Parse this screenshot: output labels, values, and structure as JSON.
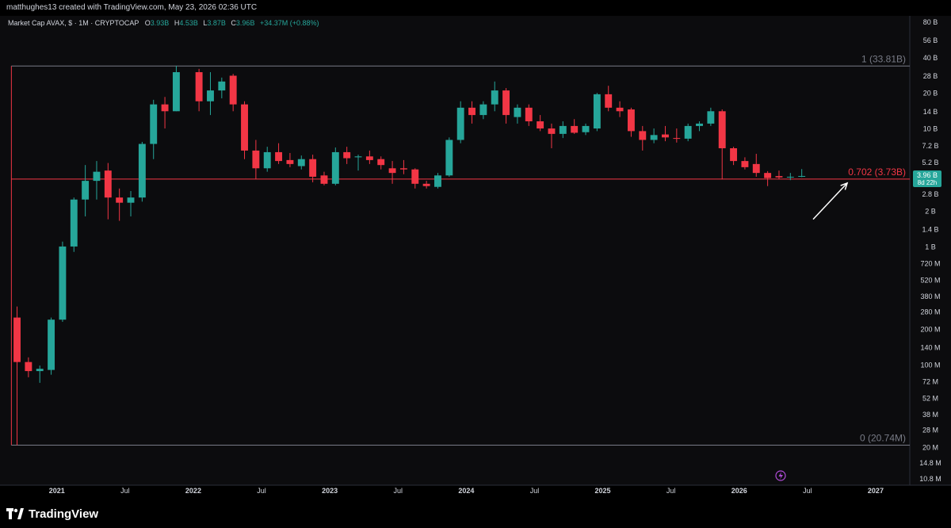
{
  "header": {
    "attribution": "matthughes13 created with TradingView.com, May 23, 2026 02:36 UTC"
  },
  "legend": {
    "symbol": "Market Cap AVAX, $ · 1M · CRYPTOCAP",
    "o_label": "O",
    "o_value": "3.93B",
    "h_label": "H",
    "h_value": "4.53B",
    "l_label": "L",
    "l_value": "3.87B",
    "c_label": "C",
    "c_value": "3.96B",
    "change": "+34.37M (+0.88%)"
  },
  "footer": {
    "brand": "TradingView"
  },
  "colors": {
    "up": "#26a69a",
    "down": "#f23645",
    "fib_line": "#f23645",
    "fib_top": "#5d606b",
    "axis_text": "#d1d4dc"
  },
  "chart_data": {
    "type": "candlestick",
    "interval": "1M",
    "y_scale": "log",
    "ylim": [
      9500000,
      90000000000
    ],
    "xlim": [
      "2020-08",
      "2027-04"
    ],
    "y_ticks": [
      {
        "label": "80 B",
        "value": 80000000000.0
      },
      {
        "label": "56 B",
        "value": 56000000000.0
      },
      {
        "label": "40 B",
        "value": 40000000000.0
      },
      {
        "label": "28 B",
        "value": 28000000000.0
      },
      {
        "label": "20 B",
        "value": 20000000000.0
      },
      {
        "label": "14 B",
        "value": 14000000000.0
      },
      {
        "label": "10 B",
        "value": 10000000000.0
      },
      {
        "label": "7.2 B",
        "value": 7200000000.0
      },
      {
        "label": "5.2 B",
        "value": 5200000000.0
      },
      {
        "label": "3.8 B",
        "value": 3800000000.0
      },
      {
        "label": "2.8 B",
        "value": 2800000000.0
      },
      {
        "label": "2 B",
        "value": 2000000000.0
      },
      {
        "label": "1.4 B",
        "value": 1400000000.0
      },
      {
        "label": "1 B",
        "value": 1000000000.0
      },
      {
        "label": "720 M",
        "value": 720000000.0
      },
      {
        "label": "520 M",
        "value": 520000000.0
      },
      {
        "label": "380 M",
        "value": 380000000.0
      },
      {
        "label": "280 M",
        "value": 280000000.0
      },
      {
        "label": "200 M",
        "value": 200000000.0
      },
      {
        "label": "140 M",
        "value": 140000000.0
      },
      {
        "label": "100 M",
        "value": 100000000.0
      },
      {
        "label": "72 M",
        "value": 72000000.0
      },
      {
        "label": "52 M",
        "value": 52000000.0
      },
      {
        "label": "38 M",
        "value": 38000000.0
      },
      {
        "label": "28 M",
        "value": 28000000.0
      },
      {
        "label": "20 M",
        "value": 20000000.0
      },
      {
        "label": "14.8 M",
        "value": 14800000.0
      },
      {
        "label": "10.8 M",
        "value": 10800000.0
      }
    ],
    "x_ticks": [
      {
        "label": "2021",
        "date": "2021-01",
        "bold": true
      },
      {
        "label": "Jul",
        "date": "2021-07",
        "bold": false
      },
      {
        "label": "2022",
        "date": "2022-01",
        "bold": true
      },
      {
        "label": "Jul",
        "date": "2022-07",
        "bold": false
      },
      {
        "label": "2023",
        "date": "2023-01",
        "bold": true
      },
      {
        "label": "Jul",
        "date": "2023-07",
        "bold": false
      },
      {
        "label": "2024",
        "date": "2024-01",
        "bold": true
      },
      {
        "label": "Jul",
        "date": "2024-07",
        "bold": false
      },
      {
        "label": "2025",
        "date": "2025-01",
        "bold": true
      },
      {
        "label": "Jul",
        "date": "2025-07",
        "bold": false
      },
      {
        "label": "2026",
        "date": "2026-01",
        "bold": true
      },
      {
        "label": "Jul",
        "date": "2026-07",
        "bold": false
      },
      {
        "label": "2027",
        "date": "2027-01",
        "bold": true
      }
    ],
    "candles": [
      {
        "date": "2020-09",
        "o": 250000000.0,
        "h": 310000000.0,
        "l": 20740000.0,
        "c": 105000000.0
      },
      {
        "date": "2020-10",
        "o": 105000000.0,
        "h": 115000000.0,
        "l": 78000000.0,
        "c": 88000000.0
      },
      {
        "date": "2020-11",
        "o": 88000000.0,
        "h": 98000000.0,
        "l": 70000000.0,
        "c": 92000000.0
      },
      {
        "date": "2020-12",
        "o": 90000000.0,
        "h": 250000000.0,
        "l": 82000000.0,
        "c": 240000000.0
      },
      {
        "date": "2021-01",
        "o": 240000000.0,
        "h": 1100000000.0,
        "l": 230000000.0,
        "c": 1000000000.0
      },
      {
        "date": "2021-02",
        "o": 1000000000.0,
        "h": 2600000000.0,
        "l": 900000000.0,
        "c": 2500000000.0
      },
      {
        "date": "2021-03",
        "o": 2500000000.0,
        "h": 4900000000.0,
        "l": 1800000000.0,
        "c": 3600000000.0
      },
      {
        "date": "2021-04",
        "o": 3600000000.0,
        "h": 5300000000.0,
        "l": 2500000000.0,
        "c": 4300000000.0
      },
      {
        "date": "2021-05",
        "o": 4400000000.0,
        "h": 5100000000.0,
        "l": 1700000000.0,
        "c": 2600000000.0
      },
      {
        "date": "2021-06",
        "o": 2600000000.0,
        "h": 3100000000.0,
        "l": 1650000000.0,
        "c": 2350000000.0
      },
      {
        "date": "2021-07",
        "o": 2350000000.0,
        "h": 2950000000.0,
        "l": 1800000000.0,
        "c": 2600000000.0
      },
      {
        "date": "2021-08",
        "o": 2600000000.0,
        "h": 7700000000.0,
        "l": 2400000000.0,
        "c": 7400000000.0
      },
      {
        "date": "2021-09",
        "o": 7400000000.0,
        "h": 17500000000.0,
        "l": 5500000000.0,
        "c": 16000000000.0
      },
      {
        "date": "2021-10",
        "o": 16000000000.0,
        "h": 18500000000.0,
        "l": 10000000000.0,
        "c": 14000000000.0
      },
      {
        "date": "2021-11",
        "o": 14000000000.0,
        "h": 34000000000.0,
        "l": 14000000000.0,
        "c": 30000000000.0
      },
      {
        "date": "2022-01",
        "o": 30000000000.0,
        "h": 32000000000.0,
        "l": 14000000000.0,
        "c": 17000000000.0
      },
      {
        "date": "2022-02",
        "o": 17000000000.0,
        "h": 30000000000.0,
        "l": 13000000000.0,
        "c": 21000000000.0
      },
      {
        "date": "2022-03",
        "o": 21000000000.0,
        "h": 27000000000.0,
        "l": 18000000000.0,
        "c": 25000000000.0
      },
      {
        "date": "2022-04",
        "o": 28000000000.0,
        "h": 29000000000.0,
        "l": 14000000000.0,
        "c": 16000000000.0
      },
      {
        "date": "2022-05",
        "o": 16000000000.0,
        "h": 17000000000.0,
        "l": 5500000000.0,
        "c": 6500000000.0
      },
      {
        "date": "2022-06",
        "o": 6500000000.0,
        "h": 8000000000.0,
        "l": 3750000000.0,
        "c": 4600000000.0
      },
      {
        "date": "2022-07",
        "o": 4600000000.0,
        "h": 7000000000.0,
        "l": 4300000000.0,
        "c": 6300000000.0
      },
      {
        "date": "2022-08",
        "o": 6300000000.0,
        "h": 7500000000.0,
        "l": 5000000000.0,
        "c": 5300000000.0
      },
      {
        "date": "2022-09",
        "o": 5400000000.0,
        "h": 6200000000.0,
        "l": 4700000000.0,
        "c": 5000000000.0
      },
      {
        "date": "2022-10",
        "o": 4800000000.0,
        "h": 5900000000.0,
        "l": 4500000000.0,
        "c": 5500000000.0
      },
      {
        "date": "2022-11",
        "o": 5500000000.0,
        "h": 6000000000.0,
        "l": 3500000000.0,
        "c": 3900000000.0
      },
      {
        "date": "2022-12",
        "o": 4000000000.0,
        "h": 4300000000.0,
        "l": 3300000000.0,
        "c": 3400000000.0
      },
      {
        "date": "2023-01",
        "o": 3400000000.0,
        "h": 6900000000.0,
        "l": 3300000000.0,
        "c": 6300000000.0
      },
      {
        "date": "2023-02",
        "o": 6300000000.0,
        "h": 7000000000.0,
        "l": 5000000000.0,
        "c": 5600000000.0
      },
      {
        "date": "2023-03",
        "o": 5700000000.0,
        "h": 6000000000.0,
        "l": 4400000000.0,
        "c": 5800000000.0
      },
      {
        "date": "2023-04",
        "o": 5800000000.0,
        "h": 6500000000.0,
        "l": 5000000000.0,
        "c": 5400000000.0
      },
      {
        "date": "2023-05",
        "o": 5500000000.0,
        "h": 5800000000.0,
        "l": 4500000000.0,
        "c": 4900000000.0
      },
      {
        "date": "2023-06",
        "o": 4600000000.0,
        "h": 5300000000.0,
        "l": 3400000000.0,
        "c": 4200000000.0
      },
      {
        "date": "2023-07",
        "o": 4600000000.0,
        "h": 5400000000.0,
        "l": 4100000000.0,
        "c": 4500000000.0
      },
      {
        "date": "2023-08",
        "o": 4500000000.0,
        "h": 4600000000.0,
        "l": 3100000000.0,
        "c": 3400000000.0
      },
      {
        "date": "2023-09",
        "o": 3400000000.0,
        "h": 3600000000.0,
        "l": 3100000000.0,
        "c": 3250000000.0
      },
      {
        "date": "2023-10",
        "o": 3200000000.0,
        "h": 4200000000.0,
        "l": 3100000000.0,
        "c": 4000000000.0
      },
      {
        "date": "2023-11",
        "o": 4000000000.0,
        "h": 8400000000.0,
        "l": 3900000000.0,
        "c": 8000000000.0
      },
      {
        "date": "2023-12",
        "o": 8000000000.0,
        "h": 17000000000.0,
        "l": 7500000000.0,
        "c": 15000000000.0
      },
      {
        "date": "2024-01",
        "o": 15000000000.0,
        "h": 17000000000.0,
        "l": 11000000000.0,
        "c": 13000000000.0
      },
      {
        "date": "2024-02",
        "o": 13000000000.0,
        "h": 17000000000.0,
        "l": 12000000000.0,
        "c": 16000000000.0
      },
      {
        "date": "2024-03",
        "o": 16000000000.0,
        "h": 25000000000.0,
        "l": 14000000000.0,
        "c": 21000000000.0
      },
      {
        "date": "2024-04",
        "o": 21000000000.0,
        "h": 22000000000.0,
        "l": 11000000000.0,
        "c": 13000000000.0
      },
      {
        "date": "2024-05",
        "o": 12500000000.0,
        "h": 16000000000.0,
        "l": 11000000000.0,
        "c": 15000000000.0
      },
      {
        "date": "2024-06",
        "o": 15000000000.0,
        "h": 16000000000.0,
        "l": 10500000000.0,
        "c": 11500000000.0
      },
      {
        "date": "2024-07",
        "o": 11500000000.0,
        "h": 13000000000.0,
        "l": 9500000000.0,
        "c": 10000000000.0
      },
      {
        "date": "2024-08",
        "o": 10000000000.0,
        "h": 11000000000.0,
        "l": 6800000000.0,
        "c": 9000000000.0
      },
      {
        "date": "2024-09",
        "o": 9000000000.0,
        "h": 11500000000.0,
        "l": 8300000000.0,
        "c": 10500000000.0
      },
      {
        "date": "2024-10",
        "o": 10500000000.0,
        "h": 12000000000.0,
        "l": 9000000000.0,
        "c": 9200000000.0
      },
      {
        "date": "2024-11",
        "o": 9300000000.0,
        "h": 11000000000.0,
        "l": 8800000000.0,
        "c": 10500000000.0
      },
      {
        "date": "2024-12",
        "o": 10000000000.0,
        "h": 20000000000.0,
        "l": 9500000000.0,
        "c": 19500000000.0
      },
      {
        "date": "2025-01",
        "o": 19500000000.0,
        "h": 23000000000.0,
        "l": 14000000000.0,
        "c": 15000000000.0
      },
      {
        "date": "2025-02",
        "o": 15000000000.0,
        "h": 17000000000.0,
        "l": 12500000000.0,
        "c": 14000000000.0
      },
      {
        "date": "2025-03",
        "o": 14500000000.0,
        "h": 15000000000.0,
        "l": 8500000000.0,
        "c": 9500000000.0
      },
      {
        "date": "2025-04",
        "o": 9500000000.0,
        "h": 10500000000.0,
        "l": 6500000000.0,
        "c": 8000000000.0
      },
      {
        "date": "2025-05",
        "o": 8000000000.0,
        "h": 10000000000.0,
        "l": 7500000000.0,
        "c": 8800000000.0
      },
      {
        "date": "2025-06",
        "o": 8900000000.0,
        "h": 10500000000.0,
        "l": 7800000000.0,
        "c": 8400000000.0
      },
      {
        "date": "2025-07",
        "o": 8300000000.0,
        "h": 10000000000.0,
        "l": 7600000000.0,
        "c": 8200000000.0
      },
      {
        "date": "2025-08",
        "o": 8200000000.0,
        "h": 11000000000.0,
        "l": 7800000000.0,
        "c": 10500000000.0
      },
      {
        "date": "2025-09",
        "o": 10500000000.0,
        "h": 11500000000.0,
        "l": 9500000000.0,
        "c": 11000000000.0
      },
      {
        "date": "2025-10",
        "o": 11000000000.0,
        "h": 15000000000.0,
        "l": 10500000000.0,
        "c": 14000000000.0
      },
      {
        "date": "2025-11",
        "o": 14000000000.0,
        "h": 14500000000.0,
        "l": 3700000000.0,
        "c": 6800000000.0
      },
      {
        "date": "2025-12",
        "o": 6800000000.0,
        "h": 7000000000.0,
        "l": 4900000000.0,
        "c": 5300000000.0
      },
      {
        "date": "2026-01",
        "o": 5300000000.0,
        "h": 5700000000.0,
        "l": 4500000000.0,
        "c": 4700000000.0
      },
      {
        "date": "2026-02",
        "o": 5000000000.0,
        "h": 6100000000.0,
        "l": 3900000000.0,
        "c": 4200000000.0
      },
      {
        "date": "2026-03",
        "o": 4200000000.0,
        "h": 4350000000.0,
        "l": 3250000000.0,
        "c": 3800000000.0
      },
      {
        "date": "2026-04",
        "o": 3950000000.0,
        "h": 4400000000.0,
        "l": 3700000000.0,
        "c": 3850000000.0
      },
      {
        "date": "2026-05",
        "o": 3850000000.0,
        "h": 4200000000.0,
        "l": 3650000000.0,
        "c": 3900000000.0
      },
      {
        "date": "2026-06",
        "o": 3930000000.0,
        "h": 4530000000.0,
        "l": 3870000000.0,
        "c": 3960000000.0
      }
    ],
    "fib_levels": [
      {
        "label": "1 (33.81B)",
        "value": 33810000000.0,
        "color": "#787b86"
      },
      {
        "label": "0.702 (3.73B)",
        "value": 3730000000.0,
        "color": "#f23645"
      },
      {
        "label": "0 (20.74M)",
        "value": 20740000.0,
        "color": "#787b86"
      }
    ],
    "fib_range": {
      "start": "2020-09",
      "end": "2027-04"
    },
    "last_price_label": {
      "price": "3.96 B",
      "countdown": "8d 22h",
      "value": 3960000000.0
    },
    "arrow_annotation": {
      "from": {
        "date": "2026-07",
        "value": 1700000000.0
      },
      "to": {
        "date": "2026-10",
        "value": 3450000000.0
      }
    }
  }
}
